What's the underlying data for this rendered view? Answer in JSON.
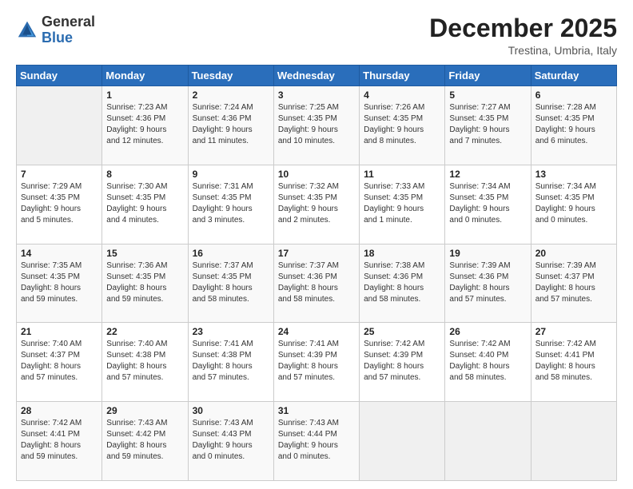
{
  "logo": {
    "general": "General",
    "blue": "Blue"
  },
  "title": "December 2025",
  "location": "Trestina, Umbria, Italy",
  "days_of_week": [
    "Sunday",
    "Monday",
    "Tuesday",
    "Wednesday",
    "Thursday",
    "Friday",
    "Saturday"
  ],
  "weeks": [
    [
      {
        "day": "",
        "detail": ""
      },
      {
        "day": "1",
        "detail": "Sunrise: 7:23 AM\nSunset: 4:36 PM\nDaylight: 9 hours\nand 12 minutes."
      },
      {
        "day": "2",
        "detail": "Sunrise: 7:24 AM\nSunset: 4:36 PM\nDaylight: 9 hours\nand 11 minutes."
      },
      {
        "day": "3",
        "detail": "Sunrise: 7:25 AM\nSunset: 4:35 PM\nDaylight: 9 hours\nand 10 minutes."
      },
      {
        "day": "4",
        "detail": "Sunrise: 7:26 AM\nSunset: 4:35 PM\nDaylight: 9 hours\nand 8 minutes."
      },
      {
        "day": "5",
        "detail": "Sunrise: 7:27 AM\nSunset: 4:35 PM\nDaylight: 9 hours\nand 7 minutes."
      },
      {
        "day": "6",
        "detail": "Sunrise: 7:28 AM\nSunset: 4:35 PM\nDaylight: 9 hours\nand 6 minutes."
      }
    ],
    [
      {
        "day": "7",
        "detail": "Sunrise: 7:29 AM\nSunset: 4:35 PM\nDaylight: 9 hours\nand 5 minutes."
      },
      {
        "day": "8",
        "detail": "Sunrise: 7:30 AM\nSunset: 4:35 PM\nDaylight: 9 hours\nand 4 minutes."
      },
      {
        "day": "9",
        "detail": "Sunrise: 7:31 AM\nSunset: 4:35 PM\nDaylight: 9 hours\nand 3 minutes."
      },
      {
        "day": "10",
        "detail": "Sunrise: 7:32 AM\nSunset: 4:35 PM\nDaylight: 9 hours\nand 2 minutes."
      },
      {
        "day": "11",
        "detail": "Sunrise: 7:33 AM\nSunset: 4:35 PM\nDaylight: 9 hours\nand 1 minute."
      },
      {
        "day": "12",
        "detail": "Sunrise: 7:34 AM\nSunset: 4:35 PM\nDaylight: 9 hours\nand 0 minutes."
      },
      {
        "day": "13",
        "detail": "Sunrise: 7:34 AM\nSunset: 4:35 PM\nDaylight: 9 hours\nand 0 minutes."
      }
    ],
    [
      {
        "day": "14",
        "detail": "Sunrise: 7:35 AM\nSunset: 4:35 PM\nDaylight: 8 hours\nand 59 minutes."
      },
      {
        "day": "15",
        "detail": "Sunrise: 7:36 AM\nSunset: 4:35 PM\nDaylight: 8 hours\nand 59 minutes."
      },
      {
        "day": "16",
        "detail": "Sunrise: 7:37 AM\nSunset: 4:35 PM\nDaylight: 8 hours\nand 58 minutes."
      },
      {
        "day": "17",
        "detail": "Sunrise: 7:37 AM\nSunset: 4:36 PM\nDaylight: 8 hours\nand 58 minutes."
      },
      {
        "day": "18",
        "detail": "Sunrise: 7:38 AM\nSunset: 4:36 PM\nDaylight: 8 hours\nand 58 minutes."
      },
      {
        "day": "19",
        "detail": "Sunrise: 7:39 AM\nSunset: 4:36 PM\nDaylight: 8 hours\nand 57 minutes."
      },
      {
        "day": "20",
        "detail": "Sunrise: 7:39 AM\nSunset: 4:37 PM\nDaylight: 8 hours\nand 57 minutes."
      }
    ],
    [
      {
        "day": "21",
        "detail": "Sunrise: 7:40 AM\nSunset: 4:37 PM\nDaylight: 8 hours\nand 57 minutes."
      },
      {
        "day": "22",
        "detail": "Sunrise: 7:40 AM\nSunset: 4:38 PM\nDaylight: 8 hours\nand 57 minutes."
      },
      {
        "day": "23",
        "detail": "Sunrise: 7:41 AM\nSunset: 4:38 PM\nDaylight: 8 hours\nand 57 minutes."
      },
      {
        "day": "24",
        "detail": "Sunrise: 7:41 AM\nSunset: 4:39 PM\nDaylight: 8 hours\nand 57 minutes."
      },
      {
        "day": "25",
        "detail": "Sunrise: 7:42 AM\nSunset: 4:39 PM\nDaylight: 8 hours\nand 57 minutes."
      },
      {
        "day": "26",
        "detail": "Sunrise: 7:42 AM\nSunset: 4:40 PM\nDaylight: 8 hours\nand 58 minutes."
      },
      {
        "day": "27",
        "detail": "Sunrise: 7:42 AM\nSunset: 4:41 PM\nDaylight: 8 hours\nand 58 minutes."
      }
    ],
    [
      {
        "day": "28",
        "detail": "Sunrise: 7:42 AM\nSunset: 4:41 PM\nDaylight: 8 hours\nand 59 minutes."
      },
      {
        "day": "29",
        "detail": "Sunrise: 7:43 AM\nSunset: 4:42 PM\nDaylight: 8 hours\nand 59 minutes."
      },
      {
        "day": "30",
        "detail": "Sunrise: 7:43 AM\nSunset: 4:43 PM\nDaylight: 9 hours\nand 0 minutes."
      },
      {
        "day": "31",
        "detail": "Sunrise: 7:43 AM\nSunset: 4:44 PM\nDaylight: 9 hours\nand 0 minutes."
      },
      {
        "day": "",
        "detail": ""
      },
      {
        "day": "",
        "detail": ""
      },
      {
        "day": "",
        "detail": ""
      }
    ]
  ]
}
